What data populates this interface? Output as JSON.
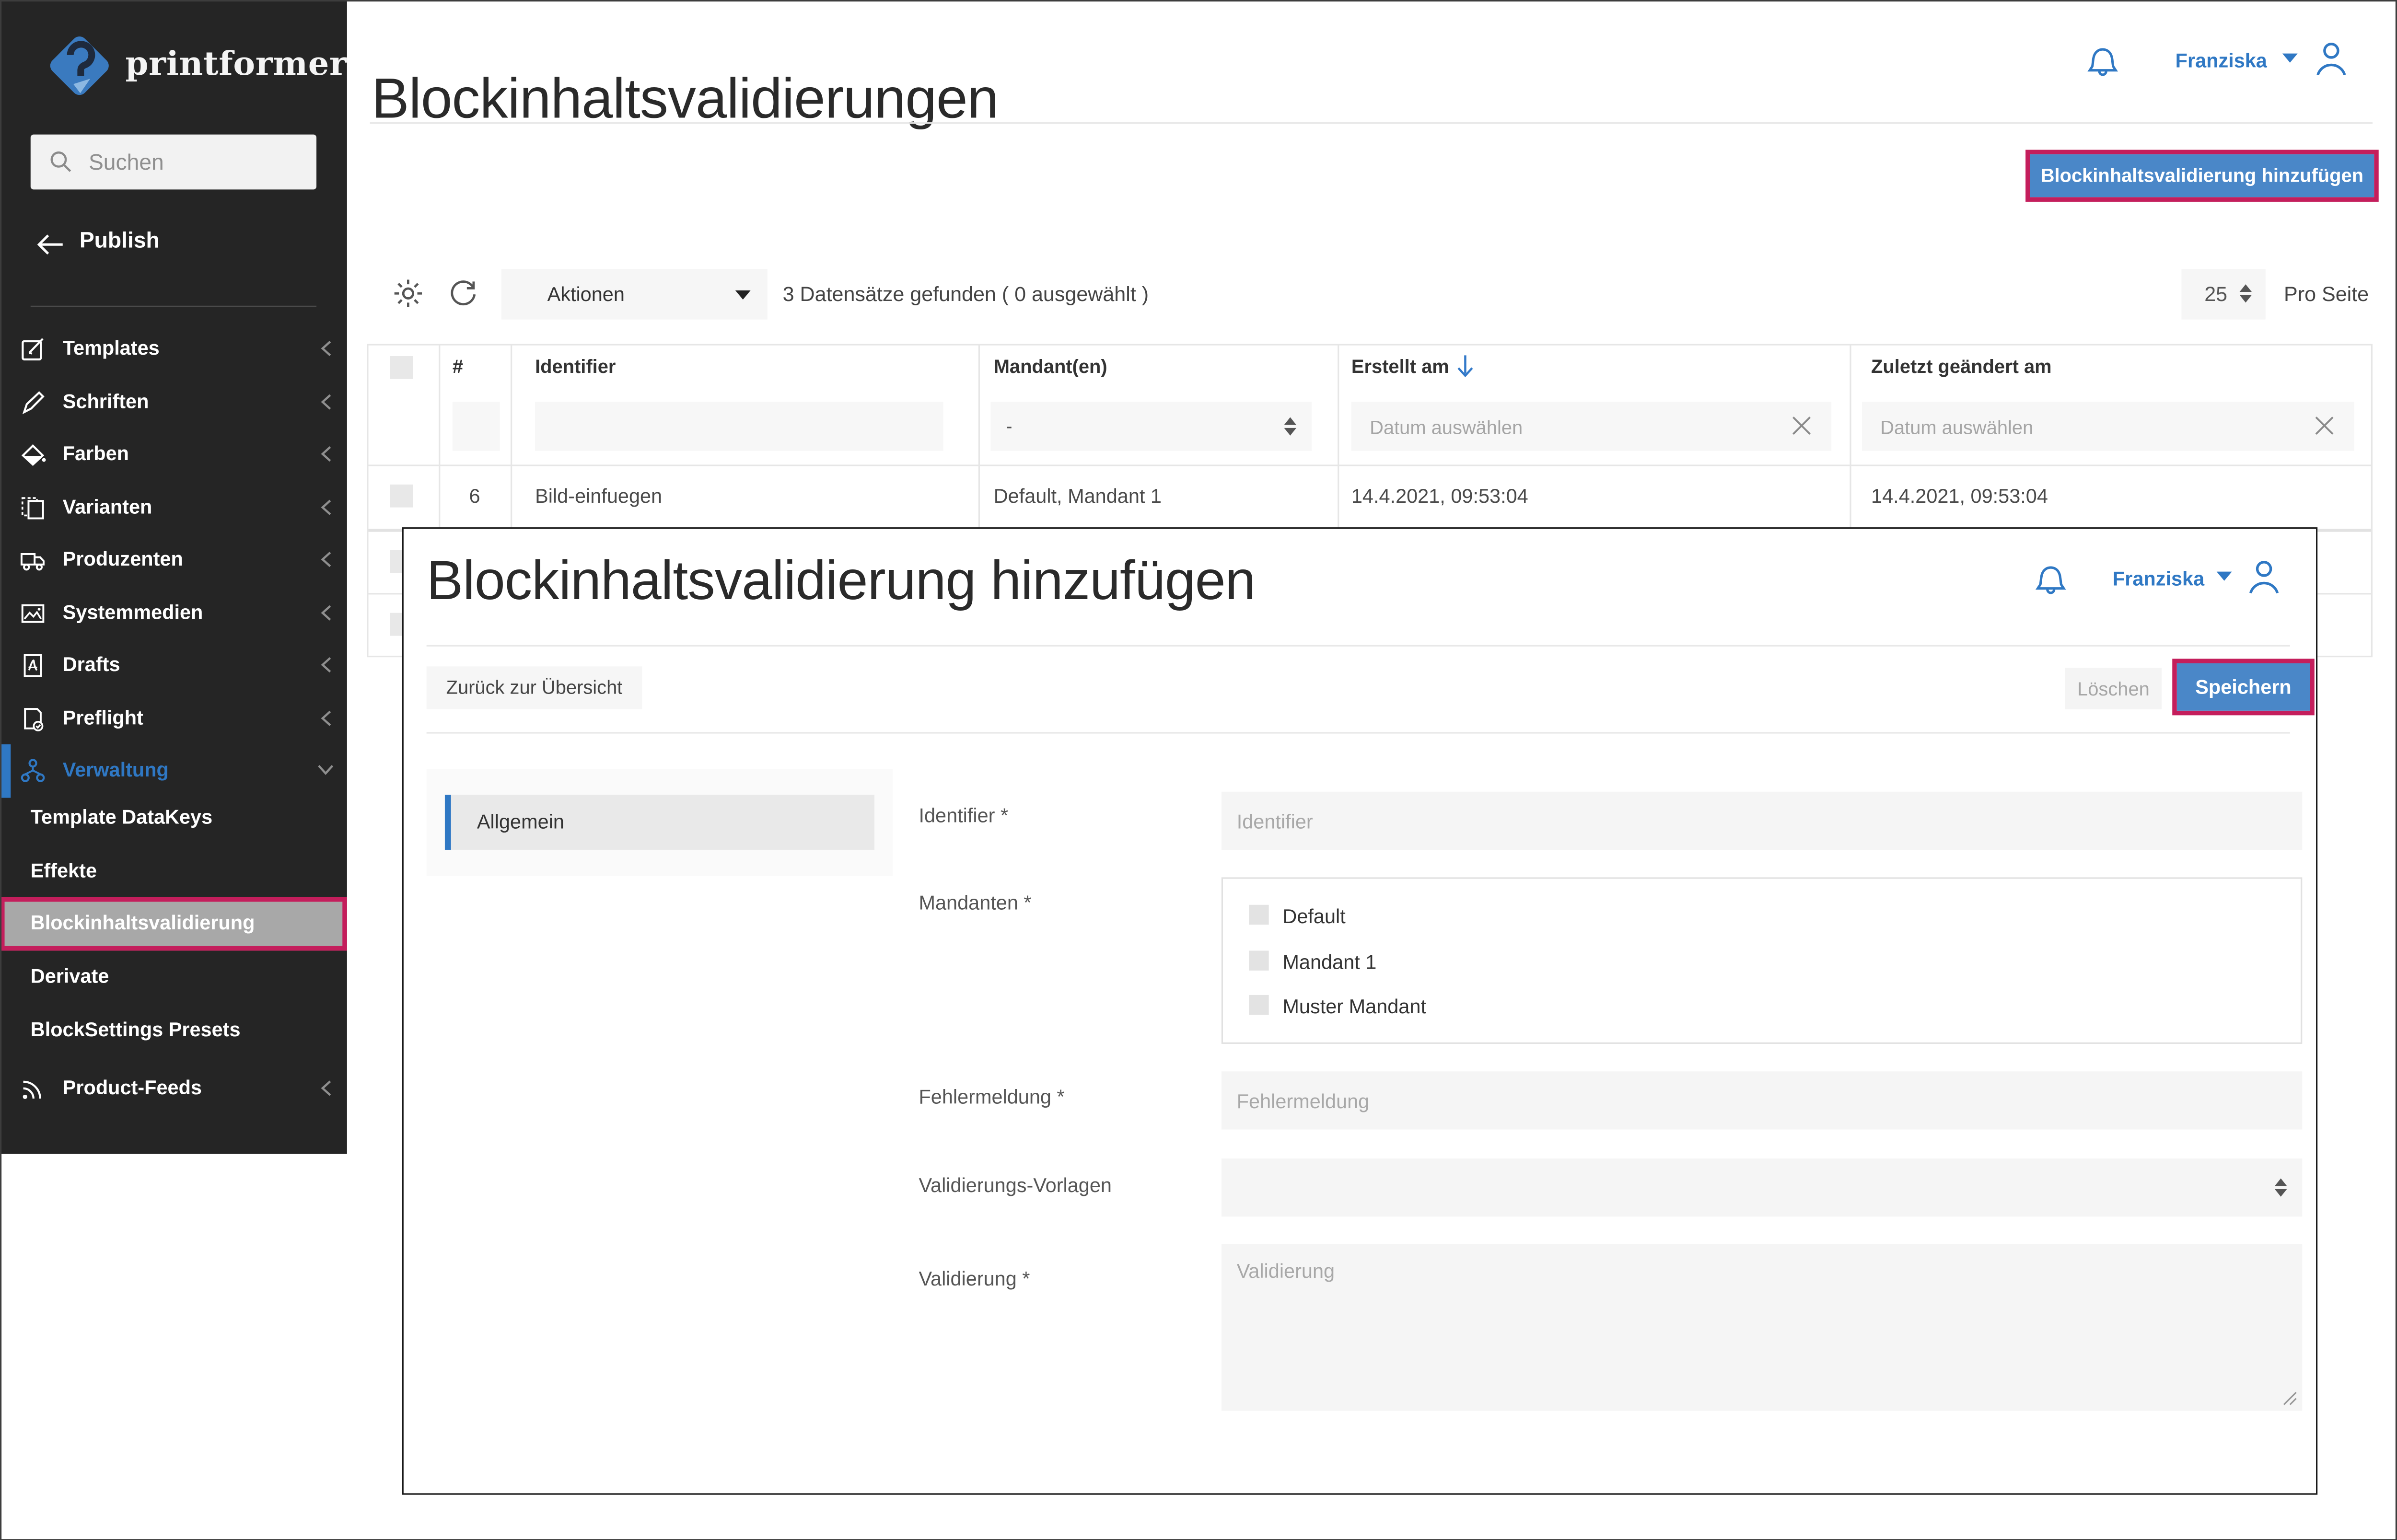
{
  "brand": "printformer",
  "sidebar": {
    "search_placeholder": "Suchen",
    "back": "Publish",
    "items": [
      {
        "label": "Templates"
      },
      {
        "label": "Schriften"
      },
      {
        "label": "Farben"
      },
      {
        "label": "Varianten"
      },
      {
        "label": "Produzenten"
      },
      {
        "label": "Systemmedien"
      },
      {
        "label": "Drafts"
      },
      {
        "label": "Preflight"
      },
      {
        "label": "Verwaltung"
      },
      {
        "label": "Template DataKeys"
      },
      {
        "label": "Effekte"
      },
      {
        "label": "Blockinhaltsvalidierung"
      },
      {
        "label": "Derivate"
      },
      {
        "label": "BlockSettings Presets"
      },
      {
        "label": "Product-Feeds"
      }
    ]
  },
  "header": {
    "title": "Blockinhaltsvalidierungen",
    "user": "Franziska"
  },
  "page": {
    "add_button": "Blockinhaltsvalidierung hinzufügen"
  },
  "toolbar": {
    "actions_label": "Aktionen",
    "summary": "3 Datensätze gefunden ( 0 ausgewählt )",
    "page_size": "25",
    "per_page_label": "Pro Seite"
  },
  "table": {
    "columns": [
      "#",
      "Identifier",
      "Mandant(en)",
      "Erstellt am",
      "Zuletzt geändert am"
    ],
    "filters": {
      "mandant_value": "-",
      "date_placeholder": "Datum auswählen"
    },
    "rows": [
      {
        "num": "6",
        "identifier": "Bild-einfuegen",
        "mandanten": "Default, Mandant 1",
        "created_at": "14.4.2021, 09:53:04",
        "updated_at": "14.4.2021, 09:53:04"
      }
    ]
  },
  "modal": {
    "title": "Blockinhaltsvalidierung hinzufügen",
    "user": "Franziska",
    "back_button": "Zurück zur Übersicht",
    "delete_button": "Löschen",
    "save_button": "Speichern",
    "tabs": [
      {
        "label": "Allgemein"
      }
    ],
    "fields": {
      "identifier_label": "Identifier *",
      "identifier_placeholder": "Identifier",
      "mandanten_label": "Mandanten *",
      "mandanten_options": [
        {
          "label": "Default"
        },
        {
          "label": "Mandant 1"
        },
        {
          "label": "Muster Mandant"
        }
      ],
      "fehlermeldung_label": "Fehlermeldung *",
      "fehlermeldung_placeholder": "Fehlermeldung",
      "vorlagen_label": "Validierungs-Vorlagen",
      "validierung_label": "Validierung *",
      "validierung_placeholder": "Validierung"
    }
  },
  "colors": {
    "accent_blue": "#4A87C8",
    "highlight_pink": "#C41E5C",
    "user_blue": "#2F78C4",
    "sidebar_bg": "#252525"
  }
}
